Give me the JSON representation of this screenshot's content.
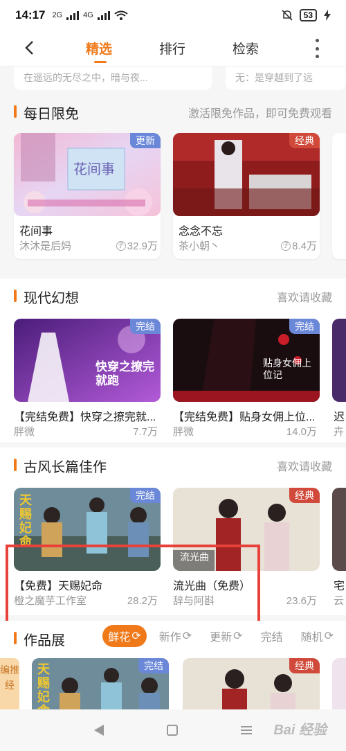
{
  "status": {
    "time": "14:17",
    "signal1": "2G",
    "signal2": "4G",
    "battery": "53"
  },
  "nav": {
    "tabs": [
      "精选",
      "排行",
      "检索"
    ],
    "active_tab": "精选"
  },
  "colors": {
    "accent": "#f07a1a",
    "tag_blue": "#6a87d8",
    "tag_red": "#d0493a",
    "highlight": "#e8413a"
  },
  "prev_strip": {
    "left_text": "在遥远的无尽之中，暗与夜...",
    "right_text": "无：是穿越到了远"
  },
  "sections": {
    "free": {
      "title": "每日限免",
      "subtitle": "激活限免作品，即可免费观看",
      "cards": [
        {
          "tag": "更新",
          "title": "花间事",
          "author": "沐沐是后妈",
          "stat": "32.9万",
          "cover_text": "花间事"
        },
        {
          "tag": "经典",
          "title": "念念不忘",
          "author": "茶小朝丶",
          "stat": "8.4万"
        }
      ]
    },
    "modern": {
      "title": "现代幻想",
      "subtitle": "喜欢请收藏",
      "cards": [
        {
          "tag": "完结",
          "title": "【完结免费】快穿之撩完就...",
          "author": "胖微",
          "stat": "7.7万",
          "cover_text": "快穿之撩完就跑"
        },
        {
          "tag": "完结",
          "title": "【完结免费】贴身女佣上位...",
          "author": "胖微",
          "stat": "14.0万",
          "cover_text": "贴身女佣上位记"
        }
      ],
      "peek": {
        "title": "迟",
        "author": "卉"
      }
    },
    "ancient": {
      "title": "古风长篇佳作",
      "subtitle": "喜欢请收藏",
      "cards": [
        {
          "tag": "完结",
          "title": "【免费】天赐妃命",
          "author": "橙之魔芋工作室",
          "stat": "28.2万",
          "cover_text": "天赐妃命"
        },
        {
          "tag": "经典",
          "title": "流光曲（免费）",
          "author": "辞与阿斟",
          "stat": "23.6万",
          "cover_text": "流光曲"
        }
      ],
      "peek": {
        "title": "宅",
        "author": "云"
      }
    },
    "works": {
      "title": "作品展",
      "filters": [
        "鲜花",
        "新作",
        "更新",
        "完结",
        "随机"
      ],
      "active_filter": "鲜花",
      "side_label": "编推经",
      "cards": [
        {
          "tag": "完结",
          "cover_text": "天赐妃命"
        },
        {
          "tag": "经典"
        }
      ]
    }
  },
  "watermark": "Bai 经验"
}
